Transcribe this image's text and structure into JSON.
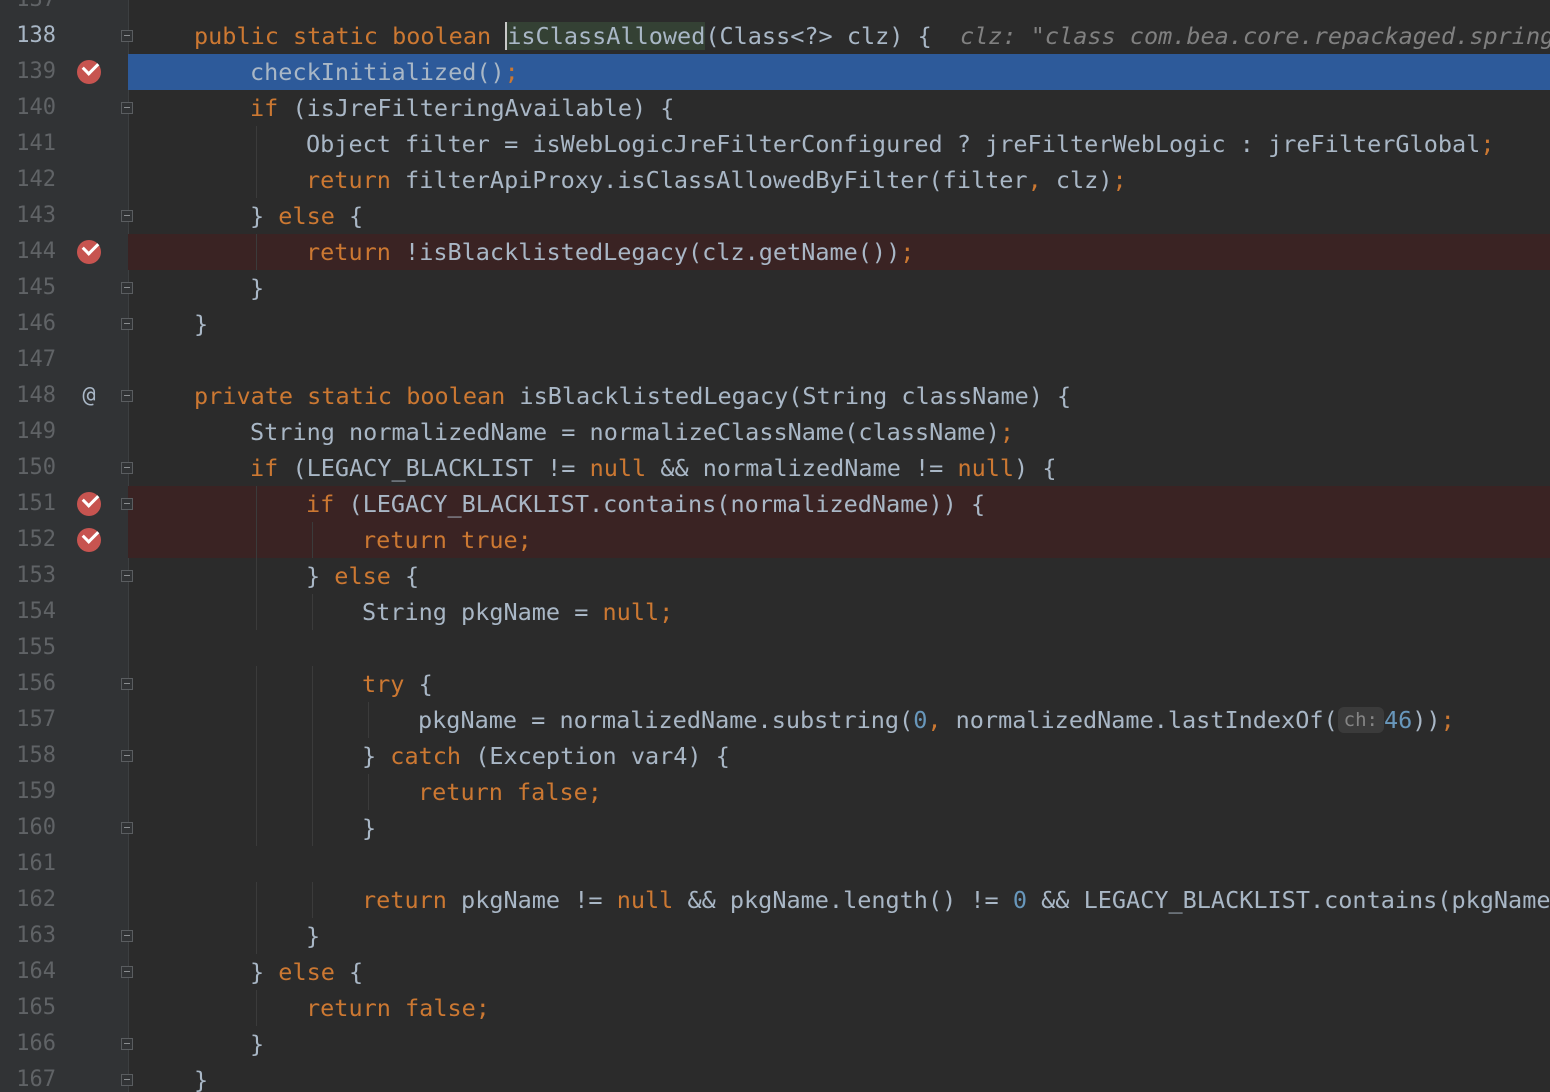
{
  "editor": {
    "first_line": 138,
    "current_line": 138,
    "execution_line": 139,
    "lines": [
      {
        "n": "137",
        "code": "",
        "tokens": [],
        "indent": 0
      },
      {
        "n": "138",
        "indent": 1,
        "fold": true,
        "tokens": [
          {
            "t": "public static boolean ",
            "c": "kw"
          },
          {
            "t": "isClassAllowed",
            "c": "ident",
            "caret": true
          },
          {
            "t": "(Class<?> clz) {  "
          },
          {
            "t": "clz: \"class com.bea.core.repackaged.springf",
            "c": "hint"
          }
        ]
      },
      {
        "n": "139",
        "indent": 2,
        "bp": true,
        "exec": true,
        "tokens": [
          {
            "t": "checkInitialized()"
          },
          {
            "t": ";",
            "c": "kw"
          }
        ]
      },
      {
        "n": "140",
        "indent": 2,
        "fold": true,
        "tokens": [
          {
            "t": "if ",
            "c": "kw"
          },
          {
            "t": "(isJreFilteringAvailable) {"
          }
        ]
      },
      {
        "n": "141",
        "indent": 3,
        "tokens": [
          {
            "t": "Object filter = isWebLogicJreFilterConfigured ? jreFilterWebLogic : jreFilterGlobal"
          },
          {
            "t": ";",
            "c": "kw"
          }
        ]
      },
      {
        "n": "142",
        "indent": 3,
        "tokens": [
          {
            "t": "return ",
            "c": "kw"
          },
          {
            "t": "filterApiProxy.isClassAllowedByFilter(filter"
          },
          {
            "t": ", ",
            "c": "kw"
          },
          {
            "t": "clz)"
          },
          {
            "t": ";",
            "c": "kw"
          }
        ]
      },
      {
        "n": "143",
        "indent": 2,
        "fold": true,
        "tokens": [
          {
            "t": "} "
          },
          {
            "t": "else ",
            "c": "kw"
          },
          {
            "t": "{"
          }
        ]
      },
      {
        "n": "144",
        "indent": 3,
        "bp": true,
        "tokens": [
          {
            "t": "return ",
            "c": "kw"
          },
          {
            "t": "!isBlacklistedLegacy(clz.getName())"
          },
          {
            "t": ";",
            "c": "kw"
          }
        ]
      },
      {
        "n": "145",
        "indent": 2,
        "fold": true,
        "tokens": [
          {
            "t": "}"
          }
        ]
      },
      {
        "n": "146",
        "indent": 1,
        "fold": true,
        "tokens": [
          {
            "t": "}"
          }
        ]
      },
      {
        "n": "147",
        "indent": 0,
        "tokens": []
      },
      {
        "n": "148",
        "indent": 1,
        "fold": true,
        "over": "@",
        "tokens": [
          {
            "t": "private static boolean ",
            "c": "kw"
          },
          {
            "t": "isBlacklistedLegacy(String className) {"
          }
        ]
      },
      {
        "n": "149",
        "indent": 2,
        "tokens": [
          {
            "t": "String normalizedName = normalizeClassName(className)"
          },
          {
            "t": ";",
            "c": "kw"
          }
        ]
      },
      {
        "n": "150",
        "indent": 2,
        "fold": true,
        "tokens": [
          {
            "t": "if ",
            "c": "kw"
          },
          {
            "t": "(LEGACY_BLACKLIST != "
          },
          {
            "t": "null ",
            "c": "kw"
          },
          {
            "t": "&& normalizedName != "
          },
          {
            "t": "null",
            "c": "kw"
          },
          {
            "t": ") {"
          }
        ]
      },
      {
        "n": "151",
        "indent": 3,
        "bp": true,
        "fold": true,
        "tokens": [
          {
            "t": "if ",
            "c": "kw"
          },
          {
            "t": "(LEGACY_BLACKLIST.contains(normalizedName)) {"
          }
        ]
      },
      {
        "n": "152",
        "indent": 4,
        "bp": true,
        "tokens": [
          {
            "t": "return true",
            "c": "kw"
          },
          {
            "t": ";",
            "c": "kw"
          }
        ]
      },
      {
        "n": "153",
        "indent": 3,
        "fold": true,
        "tokens": [
          {
            "t": "} "
          },
          {
            "t": "else ",
            "c": "kw"
          },
          {
            "t": "{"
          }
        ]
      },
      {
        "n": "154",
        "indent": 4,
        "tokens": [
          {
            "t": "String pkgName = "
          },
          {
            "t": "null;",
            "c": "kw"
          }
        ]
      },
      {
        "n": "155",
        "indent": 0,
        "tokens": []
      },
      {
        "n": "156",
        "indent": 4,
        "fold": true,
        "tokens": [
          {
            "t": "try ",
            "c": "kw"
          },
          {
            "t": "{"
          }
        ]
      },
      {
        "n": "157",
        "indent": 5,
        "tokens": [
          {
            "t": "pkgName = normalizedName.substring("
          },
          {
            "t": "0",
            "c": "num"
          },
          {
            "t": ", ",
            "c": "kw"
          },
          {
            "t": "normalizedName.lastIndexOf("
          },
          {
            "t": "ch:",
            "c": "inlay"
          },
          {
            "t": "46",
            "c": "num"
          },
          {
            "t": "))"
          },
          {
            "t": ";",
            "c": "kw"
          }
        ]
      },
      {
        "n": "158",
        "indent": 4,
        "fold": true,
        "tokens": [
          {
            "t": "} "
          },
          {
            "t": "catch ",
            "c": "kw"
          },
          {
            "t": "(Exception var4) {"
          }
        ]
      },
      {
        "n": "159",
        "indent": 5,
        "tokens": [
          {
            "t": "return false;",
            "c": "kw"
          }
        ]
      },
      {
        "n": "160",
        "indent": 4,
        "fold": true,
        "tokens": [
          {
            "t": "}"
          }
        ]
      },
      {
        "n": "161",
        "indent": 0,
        "tokens": []
      },
      {
        "n": "162",
        "indent": 4,
        "tokens": [
          {
            "t": "return ",
            "c": "kw"
          },
          {
            "t": "pkgName != "
          },
          {
            "t": "null ",
            "c": "kw"
          },
          {
            "t": "&& pkgName.length() != "
          },
          {
            "t": "0 ",
            "c": "num"
          },
          {
            "t": "&& LEGACY_BLACKLIST.contains(pkgName)"
          }
        ]
      },
      {
        "n": "163",
        "indent": 3,
        "fold": true,
        "tokens": [
          {
            "t": "}"
          }
        ]
      },
      {
        "n": "164",
        "indent": 2,
        "fold": true,
        "tokens": [
          {
            "t": "} "
          },
          {
            "t": "else ",
            "c": "kw"
          },
          {
            "t": "{"
          }
        ]
      },
      {
        "n": "165",
        "indent": 3,
        "tokens": [
          {
            "t": "return false;",
            "c": "kw"
          }
        ]
      },
      {
        "n": "166",
        "indent": 2,
        "fold": true,
        "tokens": [
          {
            "t": "}"
          }
        ]
      },
      {
        "n": "167",
        "indent": 1,
        "fold": true,
        "tokens": [
          {
            "t": "}"
          }
        ]
      }
    ]
  }
}
